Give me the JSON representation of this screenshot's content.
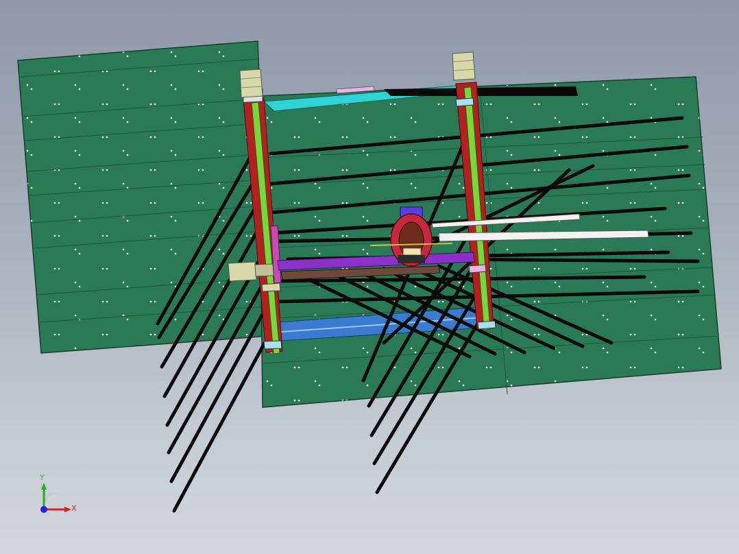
{
  "colors": {
    "plate_green": "#2b7a56",
    "plate_green_dark": "#1f5e41",
    "rail_red": "#b32020",
    "shaft_green": "#7bd63a",
    "motor_beige": "#d8d7a8",
    "carriage_magenta": "#c94ab3",
    "bar_purple": "#8a32c8",
    "bar_brown": "#6e4a3c",
    "head_blue": "#5a3fe0",
    "head_red": "#c8283e",
    "lower_blue": "#3a7bd0",
    "top_cyan": "#2fd3d3",
    "rod_black": "#0a0a0a",
    "axis_x": "#e02020",
    "axis_y": "#20b020",
    "axis_z": "#2020e0"
  },
  "triad": {
    "x_label": "X",
    "y_label": "Y"
  }
}
